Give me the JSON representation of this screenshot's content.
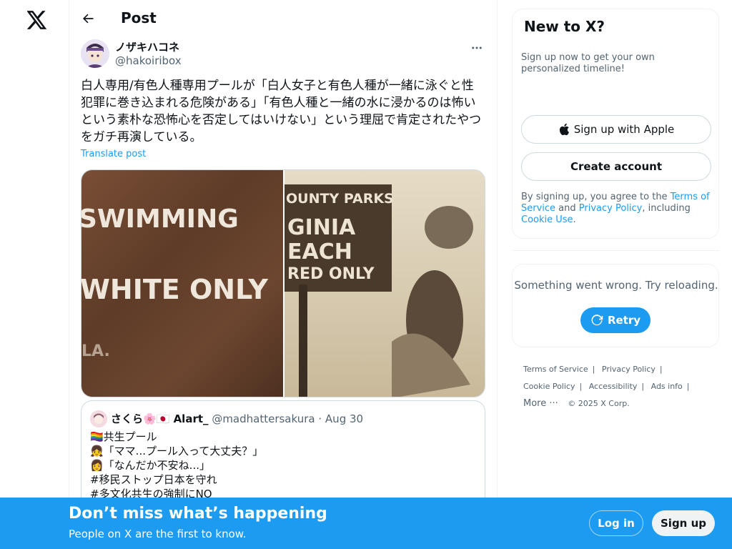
{
  "nav": {
    "logo_icon": "x-logo-icon"
  },
  "header": {
    "title": "Post",
    "back_icon": "arrow-left-icon"
  },
  "post": {
    "author_name": "ノザキハコネ",
    "author_handle": "@hakoiribox",
    "text": "白人専用/有色人種専用プールが「白人女子と有色人種が一緒に泳ぐと性\n犯罪に巻き込まれる危険がある」「有色人種と一緒の水に浸かるのは怖い\nという素朴な恐怖心を否定してはいけない」という理屈で肯定されたやつ\nをガチ再演している。",
    "translate_label": "Translate post",
    "image_left_text": [
      "SWIMMING",
      "WHITE ONLY"
    ],
    "image_right_text": [
      "OUNTY PARKS",
      "GINIA",
      "EACH",
      "RED ONLY"
    ]
  },
  "quote": {
    "name": "さくら🌸🇯🇵 Alart_",
    "handle": "@madhattersakura",
    "date": "Aug 30",
    "text": "🏳️‍🌈共生プール\n👧「ママ...プール入って大丈夫？」\n👩「なんだか不安ね...」\n#移民ストップ日本を守れ\n#多文化共生の強制にNO"
  },
  "sidebar": {
    "new_title": "New to X?",
    "new_sub": "Sign up now to get your own personalized timeline!",
    "apple_label": "Sign up with Apple",
    "create_label": "Create account",
    "legal_prefix": "By signing up, you agree to the ",
    "legal_tos": "Terms of Service",
    "legal_and": " and ",
    "legal_privacy": "Privacy Policy",
    "legal_including": ", including ",
    "legal_cookie": "Cookie Use",
    "legal_end": ".",
    "error_text": "Something went wrong. Try reloading.",
    "retry_label": "Retry"
  },
  "footer": {
    "links": [
      "Terms of Service",
      "Privacy Policy",
      "Cookie Policy",
      "Accessibility",
      "Ads info",
      "More ···"
    ],
    "copyright": "© 2025 X Corp."
  },
  "bottom": {
    "title": "Don’t miss what’s happening",
    "subtitle": "People on X are the first to know.",
    "login_label": "Log in",
    "signup_label": "Sign up"
  },
  "colors": {
    "accent": "#1d9bf0",
    "text": "#0f1419",
    "muted": "#536471"
  }
}
